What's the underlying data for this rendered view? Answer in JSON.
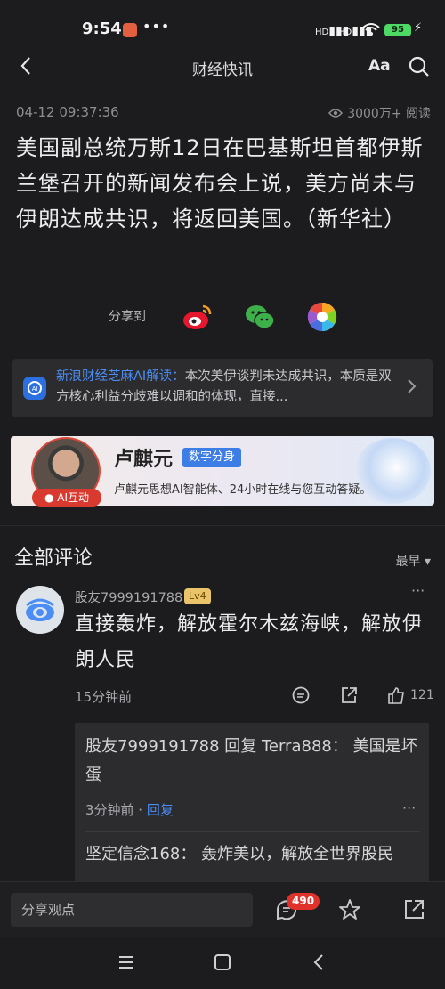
{
  "status": {
    "time": "9:54",
    "dots": "•••",
    "signal1": "HD",
    "signal2": "HD",
    "battery": "95"
  },
  "nav": {
    "title": "财经快讯",
    "font_label": "Aa",
    "back_icon": "chevron-left-icon",
    "search_icon": "search-icon"
  },
  "article": {
    "datetime": "04-12 09:37:36",
    "views": "3000万+ 阅读",
    "body": "美国副总统万斯12日在巴基斯坦首都伊斯兰堡召开的新闻发布会上说，美方尚未与伊朗达成共识，将返回美国。（新华社）"
  },
  "share": {
    "label": "分享到",
    "targets": [
      "weibo-icon",
      "wechat-icon",
      "moments-icon"
    ]
  },
  "ai_summary": {
    "source": "新浪财经芝麻AI解读：",
    "text": "本次美伊谈判未达成共识，本质是双方核心利益分歧难以调和的体现，直接..."
  },
  "banner": {
    "name": "卢麒元",
    "tag": "数字分身",
    "desc": "卢麒元思想AI智能体、24小时在线与您互动答疑。",
    "badge": "● AI互动"
  },
  "comments": {
    "title": "全部评论",
    "sort": "最早 ▾",
    "items": [
      {
        "user": "股友7999191788",
        "level": "Lv4",
        "text": "直接轰炸，解放霍尔木兹海峡，解放伊朗人民",
        "time": "15分钟前",
        "likes": "121",
        "replies": [
          {
            "text": "股友7999191788 回复 Terra888：  美国是坏蛋",
            "time": "3分钟前 · ",
            "reply_label": "回复"
          },
          {
            "text": "坚定信念168：  轰炸美以，解放全世界股民"
          }
        ]
      }
    ]
  },
  "bottom": {
    "input_placeholder": "分享观点",
    "comment_count": "490"
  },
  "colors": {
    "accent": "#4a8ef5",
    "badge_red": "#e0322a",
    "background": "#1c1c1e"
  }
}
